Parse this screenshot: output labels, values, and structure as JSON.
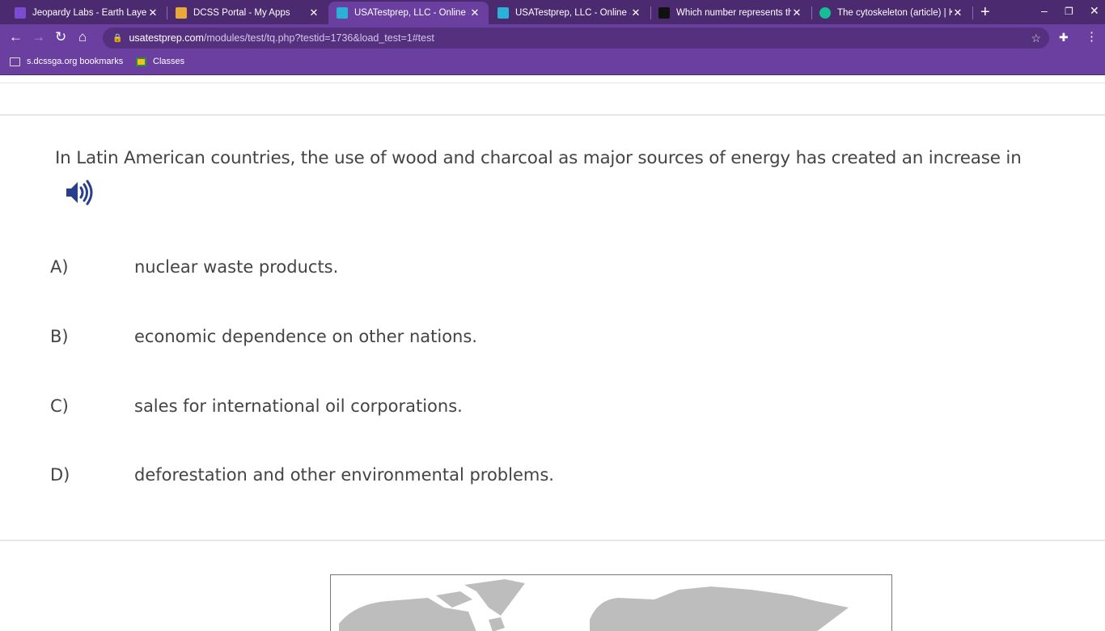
{
  "browser": {
    "tabs": [
      {
        "title": "Jeopardy Labs - Earth Layers",
        "color": "#7b4bd0"
      },
      {
        "title": "DCSS Portal - My Apps",
        "color": "#e8a93a"
      },
      {
        "title": "USATestprep, LLC - Online Sta",
        "color": "#2bb0d8"
      },
      {
        "title": "USATestprep, LLC - Online Sta",
        "color": "#2bb0d8"
      },
      {
        "title": "Which number represents the",
        "color": "#111111"
      },
      {
        "title": "The cytoskeleton (article) | Kh",
        "color": "#14bf96"
      }
    ],
    "url_host": "usatestprep.com",
    "url_path": "/modules/test/tq.php?testid=1736&load_test=1#test",
    "bookmarks": [
      "s.dcssga.org bookmarks",
      "Classes"
    ]
  },
  "question": {
    "text": "In Latin American countries, the use of wood and charcoal as major sources of energy has created an increase in",
    "answers": [
      {
        "letter": "A)",
        "text": "nuclear waste products."
      },
      {
        "letter": "B)",
        "text": "economic dependence on other nations."
      },
      {
        "letter": "C)",
        "text": "sales for international oil corporations."
      },
      {
        "letter": "D)",
        "text": "deforestation and other environmental problems."
      }
    ]
  }
}
